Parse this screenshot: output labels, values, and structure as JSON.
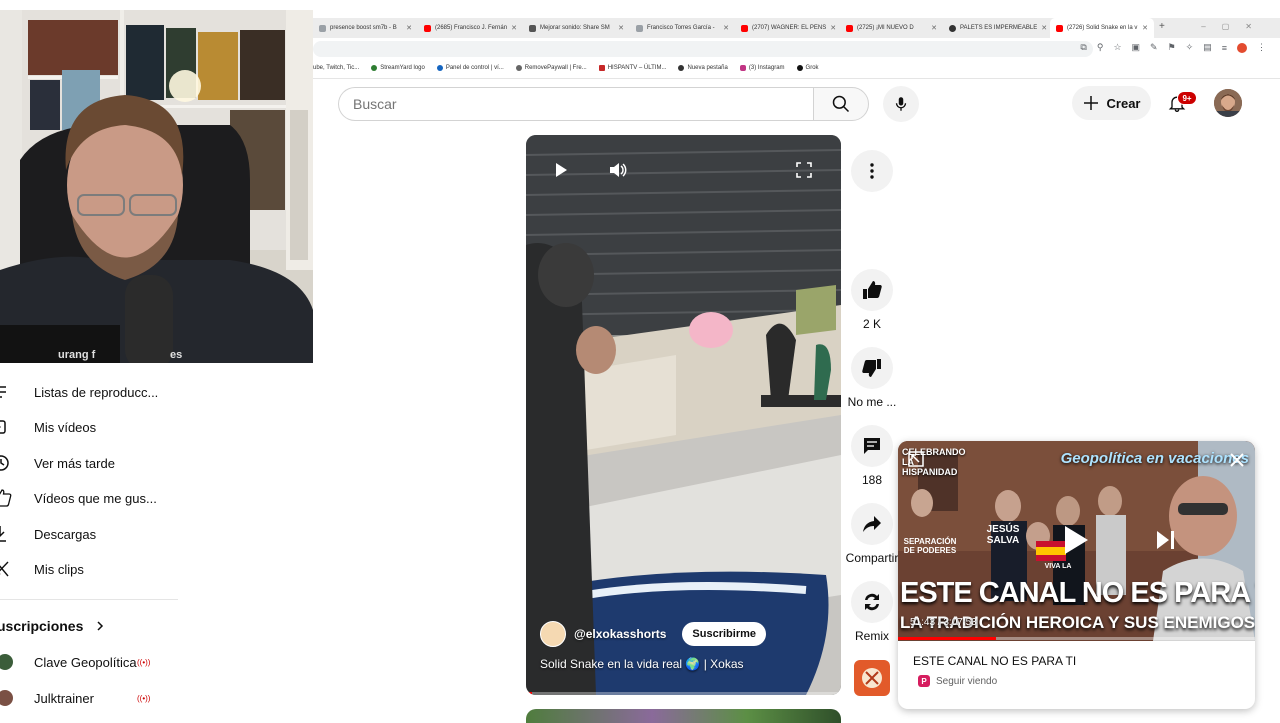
{
  "browser": {
    "tabs": [
      {
        "label": "presence boost sm7b - B",
        "color": "#9aa0a6"
      },
      {
        "label": "(2685) Francisco J. Fernán",
        "color": "#ff0000"
      },
      {
        "label": "Mejorar sonido: Share SM",
        "color": "#555555"
      },
      {
        "label": "Francisco Torres García -",
        "color": "#9aa0a6"
      },
      {
        "label": "(2707) WAGNER: EL PENS",
        "color": "#ff0000"
      },
      {
        "label": "(2725) ¡MI NUEVO D",
        "color": "#ff0000"
      },
      {
        "label": "PALETS ES IMPERMEABLE",
        "color": "#333333"
      },
      {
        "label": "(2726) Solid Snake en la v",
        "color": "#ff0000"
      }
    ],
    "new_tab": "+",
    "bookmarks": [
      "ube, Twitch, Tic...",
      "StreamYard logo",
      "Panel de control | ví...",
      "RemovePaywall | Fre...",
      "HISPANTV – ÚLTIM...",
      "Nueva pestaña",
      "(3) Instagram",
      "Grok"
    ]
  },
  "header": {
    "search_placeholder": "Buscar",
    "create_label": "Crear",
    "notification_badge": "9+"
  },
  "sidebar": {
    "items": [
      {
        "label": "Listas de reproducc...",
        "icon": "playlist-icon"
      },
      {
        "label": "Mis vídeos",
        "icon": "my-videos-icon"
      },
      {
        "label": "Ver más tarde",
        "icon": "clock-icon"
      },
      {
        "label": "Vídeos que me gus...",
        "icon": "thumb-up-icon"
      },
      {
        "label": "Descargas",
        "icon": "download-icon"
      },
      {
        "label": "Mis clips",
        "icon": "scissors-icon"
      }
    ],
    "subscriptions_heading": "uscripciones",
    "channels": [
      {
        "name": "Clave Geopolítica",
        "live": "((•))",
        "color": "#3b5d3a"
      },
      {
        "name": "Julktrainer",
        "live": "((•))",
        "color": "#7a5044"
      }
    ]
  },
  "short": {
    "channel_handle": "@elxokasshorts",
    "subscribe_label": "Suscribirme",
    "title": "Solid Snake en la vida real 🌍 | Xokas",
    "progress": 0.02
  },
  "actions": {
    "like_count": "2 K",
    "dislike_label": "No me ...",
    "comments_count": "188",
    "share_label": "Compartir",
    "remix_label": "Remix"
  },
  "mini_player": {
    "overlay_top_left": "CELEBRANDO LA HISPANIDAD",
    "overlay_top_right": "Geopolítica en vacaciones",
    "overlay_headline": "ESTE CANAL NO ES PARA TI",
    "overlay_subheadline": "LA TRADICIÓN HEROICA Y SUS ENEMIGOS",
    "overlay_signs": [
      "SEPARACIÓN DE PODERES",
      "JESÚS SALVA",
      "VIVA LA"
    ],
    "time": "51:43 / 3:07:53",
    "progress": 0.275,
    "title": "ESTE CANAL NO ES PARA TI",
    "continue_label": "Seguir viendo",
    "channel_badge": "P"
  }
}
